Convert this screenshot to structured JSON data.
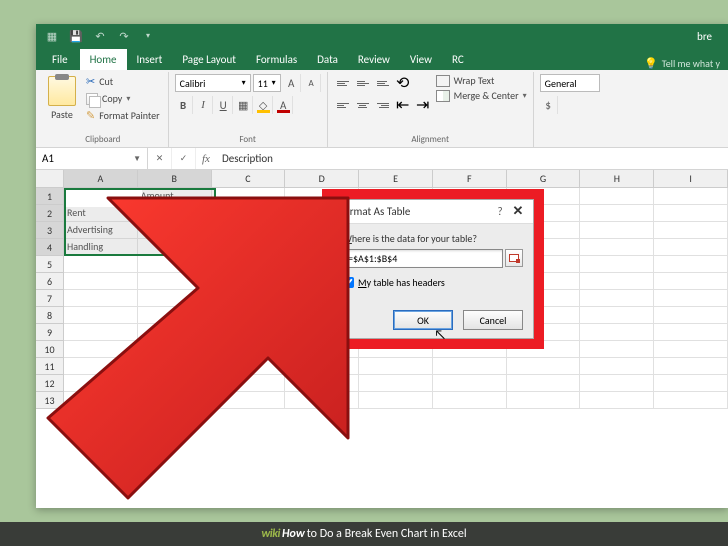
{
  "titlebar": {
    "doc_title": "bre"
  },
  "tabs": {
    "file": "File",
    "list": [
      "Home",
      "Insert",
      "Page Layout",
      "Formulas",
      "Data",
      "Review",
      "View",
      "RC"
    ],
    "active": "Home",
    "tell_me": "Tell me what y"
  },
  "ribbon": {
    "clipboard": {
      "paste": "Paste",
      "cut": "Cut",
      "copy": "Copy",
      "format_painter": "Format Painter",
      "label": "Clipboard"
    },
    "font": {
      "name": "Calibri",
      "size": "11",
      "label": "Font"
    },
    "alignment": {
      "wrap": "Wrap Text",
      "merge": "Merge & Center",
      "label": "Alignment"
    },
    "number": {
      "format": "General"
    }
  },
  "namebox": {
    "ref": "A1"
  },
  "formula_bar": {
    "value": "Description"
  },
  "columns": [
    "A",
    "B",
    "C",
    "D",
    "E",
    "F",
    "G",
    "H",
    "I"
  ],
  "rows": [
    "1",
    "2",
    "3",
    "4",
    "5",
    "6",
    "7",
    "8",
    "9",
    "10",
    "11",
    "12",
    "13"
  ],
  "table": {
    "headers": [
      "Description",
      "Amount"
    ],
    "rows": [
      [
        "Rent",
        ""
      ],
      [
        "Advertising",
        ""
      ],
      [
        "Handling",
        ""
      ]
    ]
  },
  "dialog": {
    "title": "Format As Table",
    "prompt_pre": "W",
    "prompt_rest": "here is the data for your table?",
    "range": "=$A$1:$B$4",
    "check_pre": "M",
    "check_rest": "y table has headers",
    "ok": "OK",
    "cancel": "Cancel"
  },
  "caption": {
    "brand1": "wiki",
    "brand2": "How",
    "text": " to Do a Break Even Chart in Excel"
  }
}
